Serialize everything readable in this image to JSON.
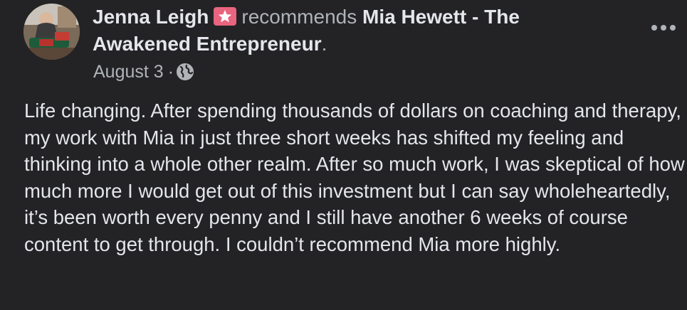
{
  "post": {
    "author_name": "Jenna Leigh",
    "verb": "recommends",
    "page_name": "Mia Hewett - The Awakened Entrepreneur",
    "page_name_line1": "Mia Hewett - The",
    "page_name_line2": "Awakened Entrepreneur",
    "trailing_period": ".",
    "date": "August 3",
    "separator": "·",
    "privacy_icon": "globe-icon",
    "badge_icon": "star-badge-icon",
    "more_icon": "more-options-icon",
    "text": "Life changing. After spending thousands of dollars on coaching and therapy, my work with Mia in just three short weeks has shifted my feeling and thinking into a whole other realm. After so much work, I was skeptical of how much more I would get out of this investment but I can say wholeheartedly, it’s been worth every penny and I still have another 6 weeks of course content to get through. I couldn’t recommend Mia more highly."
  },
  "colors": {
    "background": "#232325",
    "primary_text": "#e4e6eb",
    "secondary_text": "#b0b3b8",
    "badge": "#e9647f"
  }
}
